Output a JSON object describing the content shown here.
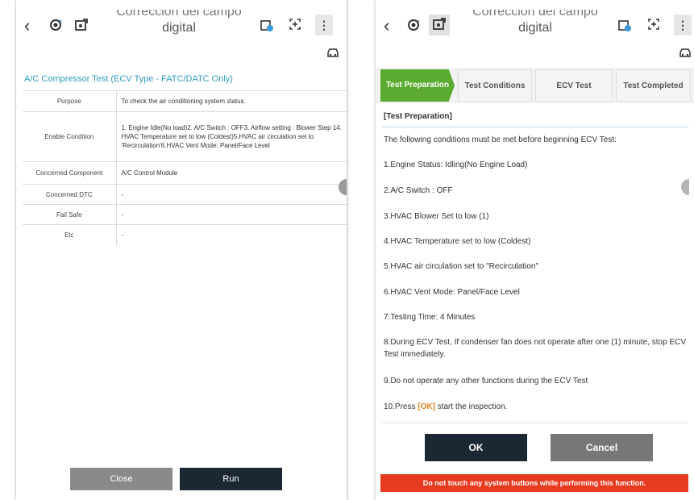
{
  "left": {
    "topbar": {
      "back_icon": "‹",
      "title": "digital",
      "title_partial": "Correccion del campo",
      "more_icon": "⋮"
    },
    "heading": "A/C Compressor Test (ECV Type - FATC/DATC Only)",
    "rows": [
      {
        "label": "Purpose",
        "value": "To check the air conditioning system status."
      },
      {
        "label": "Enable Condition",
        "value": "1. Engine Idle(No load)2. A/C Switch : OFF3. Airflow setting : Blower Step 14. HVAC Temperature set to low (Coldest)5.HVAC air circulation set to 'Recirculation'6.HVAC Vent Mode: Panel/Face Level"
      },
      {
        "label": "Concerned Component",
        "value": "A/C Control Module"
      },
      {
        "label": "Concerned DTC",
        "value": "-"
      },
      {
        "label": "Fail Safe",
        "value": "-"
      },
      {
        "label": "Etc",
        "value": "-"
      }
    ],
    "close_label": "Close",
    "run_label": "Run"
  },
  "right": {
    "topbar": {
      "back_icon": "‹",
      "title": "digital",
      "title_partial": "Correccion del campo",
      "more_icon": "⋮"
    },
    "tabs": [
      {
        "label": "Test Preparation",
        "active": true
      },
      {
        "label": "Test Conditions",
        "active": false
      },
      {
        "label": "ECV Test",
        "active": false
      },
      {
        "label": "Test Completed",
        "active": false
      }
    ],
    "section_title": "[Test Preparation]",
    "intro": "The following conditions must be met before beginning ECV Test:",
    "items": [
      "1.Engine Status: Idling(No Engine Load)",
      "2.A/C Switch : OFF",
      "3.HVAC Blower Set to low (1)",
      "4.HVAC Temperature set to low (Coldest)",
      "5.HVAC air circulation set to \"Recirculation\"",
      "6.HVAC Vent Mode: Panel/Face Level",
      "7.Testing Time: 4 Minutes",
      "8.During ECV Test, If condenser fan does not operate after one (1) minute, stop ECV Test immediately.",
      "9.Do not operate any other functions during the ECV Test"
    ],
    "press_prefix": "10.Press ",
    "press_ok": "[OK]",
    "press_suffix": " start the inspection.",
    "ok_label": "OK",
    "cancel_label": "Cancel",
    "warning": "Do not touch any system buttons while performing this function.",
    "accent_green": "#5aab2f",
    "warning_red": "#e63b1f"
  }
}
